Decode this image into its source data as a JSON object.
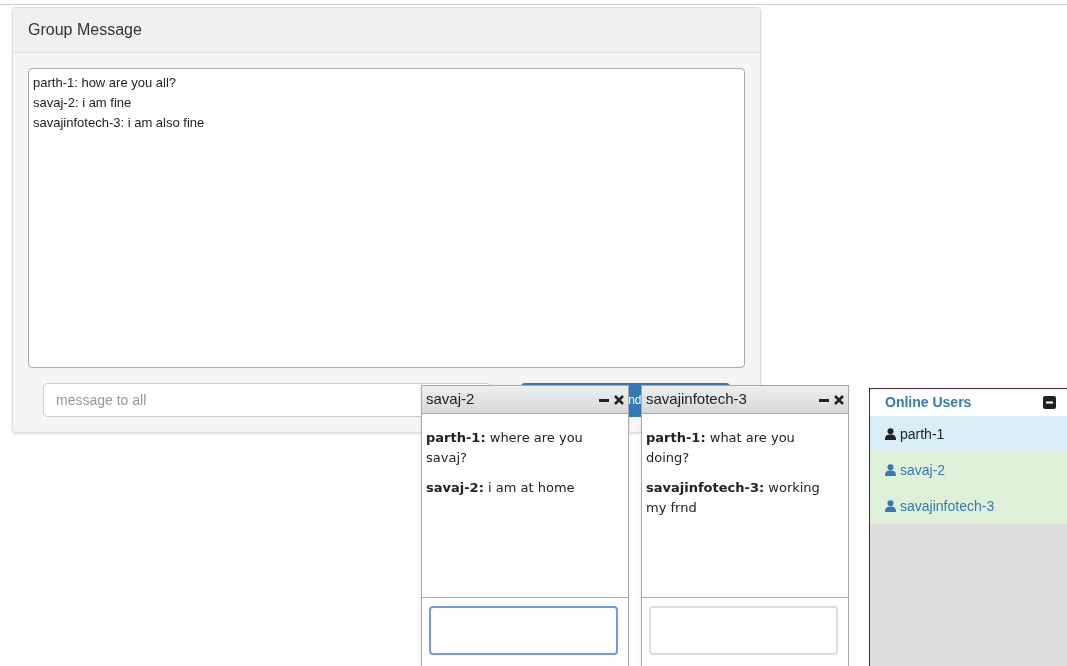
{
  "group_panel": {
    "title": "Group Message",
    "log": [
      "parth-1: how are you all?",
      "savaj-2: i am fine",
      "savajinfotech-3: i am also fine"
    ],
    "input": {
      "placeholder": "message to all"
    },
    "send_button": "nd"
  },
  "chat_windows": [
    {
      "title": "savaj-2",
      "input_focused": true,
      "messages": [
        {
          "sender": "parth-1:",
          "text": "where are you savaj?"
        },
        {
          "sender": "savaj-2:",
          "text": "i am at home"
        }
      ]
    },
    {
      "title": "savajinfotech-3",
      "input_focused": false,
      "messages": [
        {
          "sender": "parth-1:",
          "text": "what are you doing?"
        },
        {
          "sender": "savajinfotech-3:",
          "text": "working my frnd"
        }
      ]
    }
  ],
  "online_users": {
    "title": "Online Users",
    "users": [
      {
        "name": "parth-1",
        "selected": true
      },
      {
        "name": "savaj-2",
        "selected": false
      },
      {
        "name": "savajinfotech-3",
        "selected": false
      }
    ]
  }
}
